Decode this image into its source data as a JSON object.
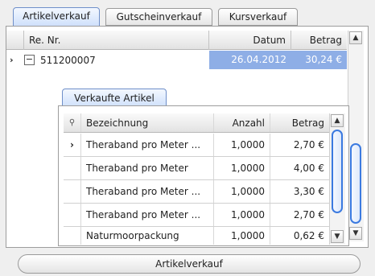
{
  "tabs": [
    "Artikelverkauf",
    "Gutscheinverkauf",
    "Kursverkauf"
  ],
  "main_table": {
    "columns": [
      "Re. Nr.",
      "Datum",
      "Betrag"
    ],
    "row": {
      "rechnung": "511200007",
      "datum": "26.04.2012",
      "betrag": "30,24 €"
    }
  },
  "detail": {
    "tab": "Verkaufte Artikel",
    "columns": [
      "Bezeichnung",
      "Anzahl",
      "Betrag"
    ],
    "rows": [
      {
        "bezeichnung": "Theraband pro Meter ...",
        "anzahl": "1,0000",
        "betrag": "2,70 €"
      },
      {
        "bezeichnung": "Theraband pro Meter",
        "anzahl": "1,0000",
        "betrag": "4,00 €"
      },
      {
        "bezeichnung": "Theraband pro Meter ...",
        "anzahl": "1,0000",
        "betrag": "3,30 €"
      },
      {
        "bezeichnung": "Theraband pro Meter ...",
        "anzahl": "1,0000",
        "betrag": "2,70 €"
      },
      {
        "bezeichnung": "Naturmoorpackung",
        "anzahl": "1,0000",
        "betrag": "0,62 €"
      }
    ]
  },
  "bottom_button": "Artikelverkauf",
  "colors": {
    "selection": "#8eaee6",
    "accent": "#3b7ae0"
  }
}
